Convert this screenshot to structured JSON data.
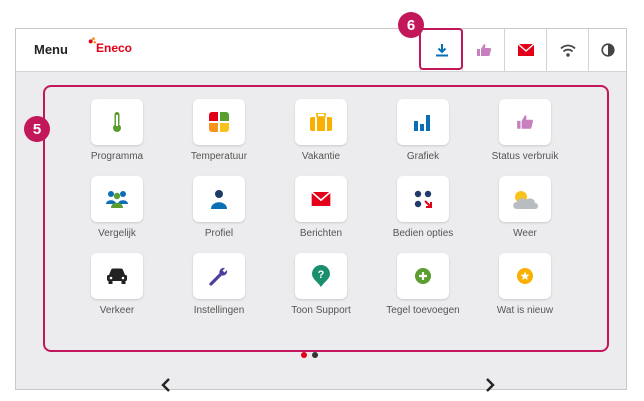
{
  "topbar": {
    "menu_label": "Menu",
    "brand": "Eneco",
    "buttons": [
      {
        "name": "download-icon",
        "color": "#0a6fb5"
      },
      {
        "name": "thumbs-up-icon",
        "color": "#c77fc0"
      },
      {
        "name": "envelope-icon",
        "color": "#e2001a"
      },
      {
        "name": "wifi-icon",
        "color": "#444444"
      },
      {
        "name": "contrast-icon",
        "color": "#444444"
      }
    ]
  },
  "annotations": {
    "badge_grid": "5",
    "badge_download": "6"
  },
  "tiles": [
    {
      "label": "Programma",
      "icon": "thermometer-icon"
    },
    {
      "label": "Temperatuur",
      "icon": "temperature-grid-icon"
    },
    {
      "label": "Vakantie",
      "icon": "suitcase-icon"
    },
    {
      "label": "Grafiek",
      "icon": "bar-chart-icon"
    },
    {
      "label": "Status verbruik",
      "icon": "thumbs-up-icon"
    },
    {
      "label": "Vergelijk",
      "icon": "people-group-icon"
    },
    {
      "label": "Profiel",
      "icon": "person-icon"
    },
    {
      "label": "Berichten",
      "icon": "envelope-icon"
    },
    {
      "label": "Bedien opties",
      "icon": "control-options-icon"
    },
    {
      "label": "Weer",
      "icon": "weather-icon"
    },
    {
      "label": "Verkeer",
      "icon": "car-icon"
    },
    {
      "label": "Instellingen",
      "icon": "wrench-icon"
    },
    {
      "label": "Toon Support",
      "icon": "support-icon"
    },
    {
      "label": "Tegel toevoegen",
      "icon": "add-tile-icon"
    },
    {
      "label": "Wat is nieuw",
      "icon": "star-icon"
    }
  ],
  "pagination": {
    "current": 1,
    "total": 2,
    "active_color": "#e2001a",
    "inactive_color": "#333333"
  },
  "colors": {
    "accent": "#c2185b",
    "brand": "#e2001a"
  }
}
